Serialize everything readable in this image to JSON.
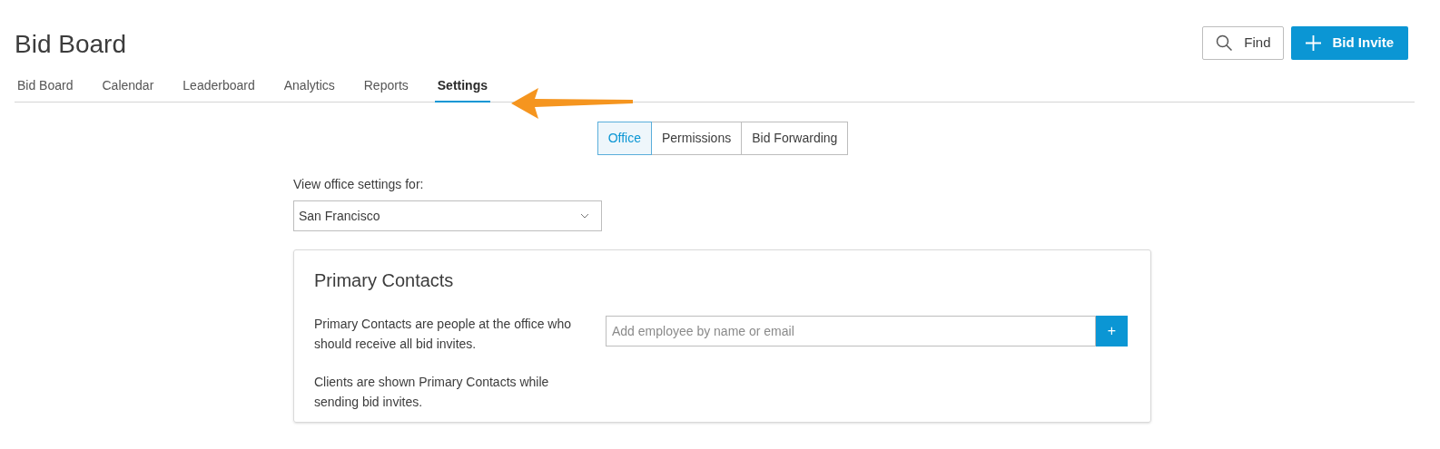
{
  "header": {
    "title": "Bid Board",
    "find_button": "Find",
    "invite_button": "Bid Invite"
  },
  "tabs": [
    {
      "label": "Bid Board",
      "selected": false
    },
    {
      "label": "Calendar",
      "selected": false
    },
    {
      "label": "Leaderboard",
      "selected": false
    },
    {
      "label": "Analytics",
      "selected": false
    },
    {
      "label": "Reports",
      "selected": false
    },
    {
      "label": "Settings",
      "selected": true
    }
  ],
  "settings_tabs": [
    {
      "label": "Office",
      "selected": true
    },
    {
      "label": "Permissions",
      "selected": false
    },
    {
      "label": "Bid Forwarding",
      "selected": false
    }
  ],
  "office_select": {
    "label": "View office settings for:",
    "value": "San Francisco"
  },
  "primary_contacts": {
    "title": "Primary Contacts",
    "paragraphs": [
      "Primary Contacts are people at the office who should receive all bid invites.",
      "Clients are shown Primary Contacts while sending bid invites."
    ],
    "placeholder": "Add employee by name or email",
    "add_button": "+"
  }
}
